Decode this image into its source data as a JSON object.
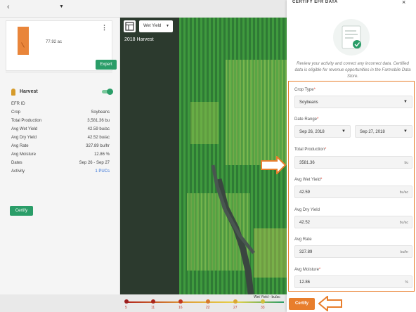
{
  "header": {
    "back_glyph": "‹",
    "dropdown_glyph": "▼"
  },
  "field_card": {
    "acres": "77.92 ac",
    "menu_glyph": "⋮",
    "expert_label": "Expert"
  },
  "harvest": {
    "title": "Harvest",
    "toggle_on": true
  },
  "properties": [
    {
      "key": "EFR ID",
      "value": ""
    },
    {
      "key": "Crop",
      "value": "Soybeans"
    },
    {
      "key": "Total Production",
      "value": "3,581.36 bu"
    },
    {
      "key": "Avg Wet Yield",
      "value": "42.59 bu/ac"
    },
    {
      "key": "Avg Dry Yield",
      "value": "42.52 bu/ac"
    },
    {
      "key": "Avg Rate",
      "value": "327.89 bu/hr"
    },
    {
      "key": "Avg Moisture",
      "value": "12.86 %"
    },
    {
      "key": "Dates",
      "value": "Sep 26 - Sep 27"
    },
    {
      "key": "Activity",
      "value": "1 PUCs"
    }
  ],
  "left_certify_label": "Certify",
  "map": {
    "layer_select": "Wet Yield",
    "year_label": "2018 Harvest"
  },
  "legend": {
    "title": "Wet Yield - bu/ac",
    "ticks": [
      "5",
      "11",
      "16",
      "22",
      "27",
      "33"
    ]
  },
  "drawer": {
    "title": "CERTIFY EFR DATA",
    "close_glyph": "×",
    "note": "Review your activity and correct any incorrect data. Certified data is eligible for revenue opportunities in the Farmobile Data Store.",
    "crop_type_label": "Crop Type",
    "crop_type_value": "Soybeans",
    "date_range_label": "Date Range",
    "date_start": "Sep 26, 2018",
    "date_end": "Sep 27, 2018",
    "total_production_label": "Total Production",
    "total_production_value": "3581.36",
    "total_production_unit": "bu",
    "avg_wet_yield_label": "Avg Wet Yield",
    "avg_wet_yield_value": "42.59",
    "avg_wet_yield_unit": "bu/ac",
    "avg_dry_yield_label": "Avg Dry Yield",
    "avg_dry_yield_value": "42.52",
    "avg_dry_yield_unit": "bu/ac",
    "avg_rate_label": "Avg Rate",
    "avg_rate_value": "327.89",
    "avg_rate_unit": "bu/hr",
    "avg_moisture_label": "Avg Moisture",
    "avg_moisture_value": "12.86",
    "avg_moisture_unit": "%",
    "certify_label": "Certify",
    "required_mark": "*"
  },
  "colors": {
    "accent_green": "#2a9d68",
    "accent_orange": "#e87e2c",
    "link_blue": "#2b6bd6"
  }
}
